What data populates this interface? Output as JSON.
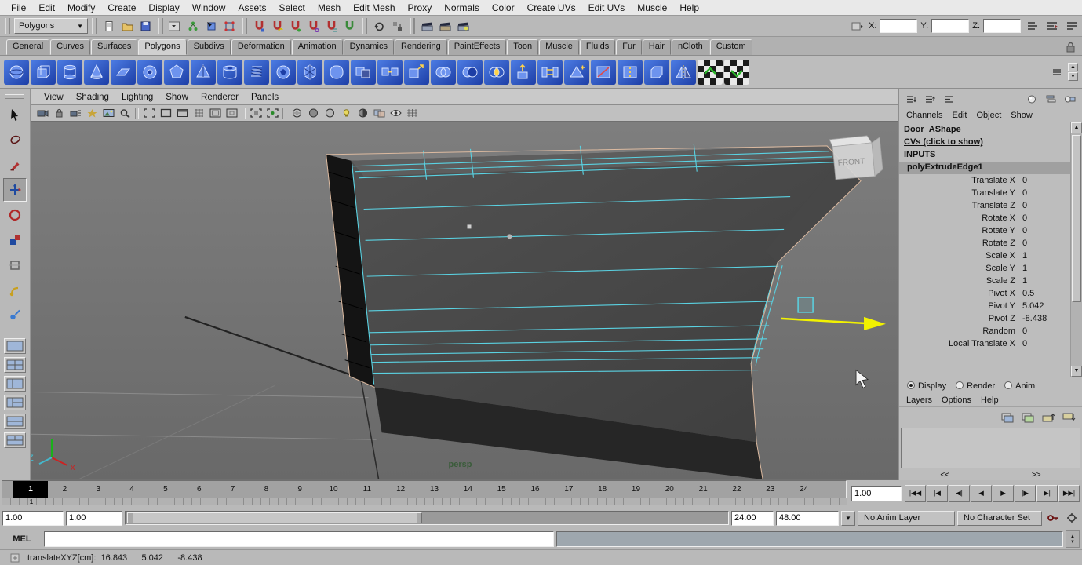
{
  "menubar": {
    "items": [
      "File",
      "Edit",
      "Modify",
      "Create",
      "Display",
      "Window",
      "Assets",
      "Select",
      "Mesh",
      "Edit Mesh",
      "Proxy",
      "Normals",
      "Color",
      "Create UVs",
      "Edit UVs",
      "Muscle",
      "Help"
    ]
  },
  "status": {
    "menuset": "Polygons",
    "x_label": "X:",
    "y_label": "Y:",
    "z_label": "Z:",
    "x_value": "",
    "y_value": "",
    "z_value": "",
    "icons": [
      "new-scene",
      "open-scene",
      "save-scene",
      "selection-mask-dropdown",
      "select-hierarchy",
      "select-object",
      "select-component",
      "snap-to-grid",
      "snap-to-curve",
      "snap-to-point",
      "snap-to-projected-center",
      "snap-to-view-plane",
      "make-live",
      "construction-history",
      "list-input-connections",
      "render-current-frame",
      "ipr-render",
      "render-settings",
      "show-ui-lines-1",
      "show-ui-lines-2",
      "show-ui-lines-3"
    ]
  },
  "shelf": {
    "tabs": [
      "General",
      "Curves",
      "Surfaces",
      "Polygons",
      "Subdivs",
      "Deformation",
      "Animation",
      "Dynamics",
      "Rendering",
      "PaintEffects",
      "Toon",
      "Muscle",
      "Fluids",
      "Fur",
      "Hair",
      "nCloth",
      "Custom"
    ],
    "active_tab": "Polygons",
    "icons": [
      "poly-sphere",
      "poly-cube",
      "poly-cylinder",
      "poly-cone",
      "poly-plane",
      "poly-torus",
      "poly-prism",
      "poly-pyramid",
      "poly-pipe",
      "poly-helix",
      "poly-soccer-ball",
      "poly-platonic-solid",
      "smooth",
      "combine",
      "separate",
      "extract",
      "boolean-union",
      "boolean-difference",
      "boolean-intersection",
      "extrude",
      "bridge",
      "append-to-polygon",
      "split-polygon",
      "insert-edge-loop",
      "bevel",
      "mirror-geometry",
      "uv-checker-a",
      "uv-checker-b"
    ]
  },
  "toolbox": {
    "tools": [
      "select-tool",
      "lasso-select-tool",
      "paint-selection-tool",
      "move-tool",
      "rotate-tool",
      "scale-tool",
      "universal-manipulator-tool",
      "soft-modification-tool",
      "show-manipulator-tool"
    ],
    "layouts": [
      "single-pane-layout",
      "four-pane-layout",
      "two-pane-side-layout",
      "persp-outliner-layout",
      "two-pane-stacked-layout",
      "three-pane-layout"
    ]
  },
  "panel_menu": {
    "items": [
      "View",
      "Shading",
      "Lighting",
      "Show",
      "Renderer",
      "Panels"
    ]
  },
  "viewport": {
    "camera_label": "persp",
    "viewcube_front": "FRONT",
    "axis_x": "x",
    "axis_z": "Z"
  },
  "channel_box": {
    "menus": [
      "Channels",
      "Edit",
      "Object",
      "Show"
    ],
    "shape": "Door_AShape",
    "cvs": "CVs (click to show)",
    "inputs": "INPUTS",
    "node": "polyExtrudeEdge1",
    "attributes": [
      {
        "name": "Translate X",
        "value": "0"
      },
      {
        "name": "Translate Y",
        "value": "0"
      },
      {
        "name": "Translate Z",
        "value": "0"
      },
      {
        "name": "Rotate X",
        "value": "0"
      },
      {
        "name": "Rotate Y",
        "value": "0"
      },
      {
        "name": "Rotate Z",
        "value": "0"
      },
      {
        "name": "Scale X",
        "value": "1"
      },
      {
        "name": "Scale Y",
        "value": "1"
      },
      {
        "name": "Scale Z",
        "value": "1"
      },
      {
        "name": "Pivot X",
        "value": "0.5"
      },
      {
        "name": "Pivot Y",
        "value": "5.042"
      },
      {
        "name": "Pivot Z",
        "value": "-8.438"
      },
      {
        "name": "Random",
        "value": "0"
      },
      {
        "name": "Local Translate X",
        "value": "0"
      }
    ]
  },
  "layer_editor": {
    "radios": [
      "Display",
      "Render",
      "Anim"
    ],
    "selected_radio": "Display",
    "menus": [
      "Layers",
      "Options",
      "Help"
    ],
    "collapse_left": "<<",
    "collapse_right": ">>"
  },
  "timeline": {
    "frames": [
      "1",
      "2",
      "3",
      "4",
      "5",
      "6",
      "7",
      "8",
      "9",
      "10",
      "11",
      "12",
      "13",
      "14",
      "15",
      "16",
      "17",
      "18",
      "19",
      "20",
      "21",
      "22",
      "23",
      "24"
    ],
    "current_frame": "1",
    "current_time": "1.00",
    "playback_icons": [
      "|◀◀",
      "|◀",
      "◀|",
      "◀",
      "▶",
      "|▶",
      "▶|",
      "▶▶|"
    ]
  },
  "range": {
    "anim_start": "1.00",
    "playback_start": "1.00",
    "playback_end": "24.00",
    "anim_end": "48.00",
    "anim_layer": "No Anim Layer",
    "character_set": "No Character Set"
  },
  "command_line": {
    "label": "MEL",
    "input": "",
    "result": ""
  },
  "help_line": {
    "text": "translateXYZ[cm]:  16.843      5.042      -8.438"
  }
}
